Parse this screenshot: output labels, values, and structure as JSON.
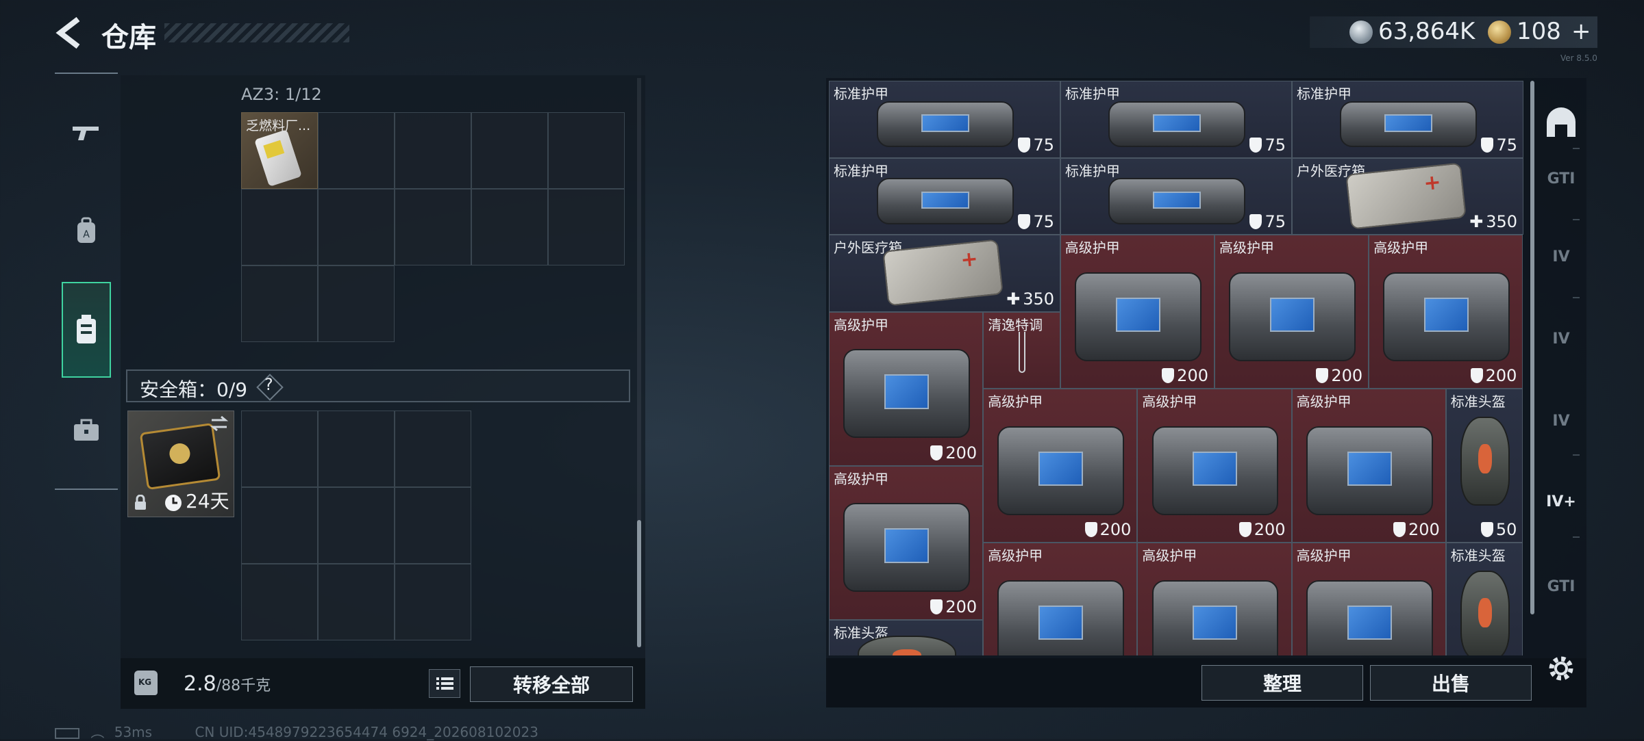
{
  "header": {
    "title": "仓库",
    "currency_silver": "63,864K",
    "currency_gold": "108",
    "gold_plus": "+",
    "version_text": "Ver 8.5.0"
  },
  "left_nav": {
    "items": [
      "rifle-icon",
      "backpack-icon",
      "vest-icon",
      "toolbox-icon"
    ],
    "active": "vest-icon"
  },
  "container": {
    "label": "AZ3: 1/12",
    "item_label": "乏燃料厂...",
    "safebox_label": "安全箱：0/9",
    "safebox_help": "?",
    "safe_item_timer": "24天"
  },
  "bottom_left": {
    "weight_current": "2.8",
    "weight_max": "/88千克",
    "transfer_label": "转移全部"
  },
  "status_bar": {
    "ping": "53ms",
    "uid": "CN UID:4548979223654474 6924_202608102023"
  },
  "inventory": {
    "cells": [
      {
        "label": "标准护甲",
        "value": "75",
        "type": "std",
        "kind": "bag"
      },
      {
        "label": "标准护甲",
        "value": "75",
        "type": "std",
        "kind": "bag"
      },
      {
        "label": "标准护甲",
        "value": "75",
        "type": "std",
        "kind": "bag"
      },
      {
        "label": "标准护甲",
        "value": "75",
        "type": "std",
        "kind": "bag"
      },
      {
        "label": "标准护甲",
        "value": "75",
        "type": "std",
        "kind": "bag"
      },
      {
        "label": "户外医疗箱",
        "value": "350",
        "type": "std",
        "kind": "medkit"
      },
      {
        "label": "户外医疗箱",
        "value": "350",
        "type": "std",
        "kind": "medkit"
      },
      {
        "label": "高级护甲",
        "value": "200",
        "type": "adv",
        "kind": "bag"
      },
      {
        "label": "高级护甲",
        "value": "200",
        "type": "adv",
        "kind": "bag"
      },
      {
        "label": "高级护甲",
        "value": "200",
        "type": "adv",
        "kind": "bag"
      },
      {
        "label": "高级护甲",
        "value": "200",
        "type": "adv",
        "kind": "bag"
      },
      {
        "label": "清逸特调",
        "value": "",
        "type": "adv",
        "kind": "glass"
      },
      {
        "label": "高级护甲",
        "value": "200",
        "type": "adv",
        "kind": "bag"
      },
      {
        "label": "高级护甲",
        "value": "200",
        "type": "adv",
        "kind": "bag"
      },
      {
        "label": "高级护甲",
        "value": "200",
        "type": "adv",
        "kind": "bag"
      },
      {
        "label": "标准头盔",
        "value": "50",
        "type": "std",
        "kind": "helmet"
      },
      {
        "label": "高级护甲",
        "value": "200",
        "type": "adv",
        "kind": "bag"
      },
      {
        "label": "高级护甲",
        "value": "",
        "type": "adv",
        "kind": "bag"
      },
      {
        "label": "高级护甲",
        "value": "",
        "type": "adv",
        "kind": "bag"
      },
      {
        "label": "高级护甲",
        "value": "",
        "type": "adv",
        "kind": "bag"
      },
      {
        "label": "标准头盔",
        "value": "",
        "type": "std",
        "kind": "helmet"
      },
      {
        "label": "标准头盔",
        "value": "",
        "type": "std",
        "kind": "helmet"
      }
    ]
  },
  "right_bottom": {
    "sort_label": "整理",
    "sell_label": "出售"
  },
  "right_nav": {
    "items": [
      "helmet-slot-icon",
      "gti-icon",
      "iv-backpack-icon",
      "iv-backpack-icon",
      "iv-backpack-icon",
      "iv-add-icon",
      "gti-lock-icon",
      "settings-icon"
    ]
  }
}
